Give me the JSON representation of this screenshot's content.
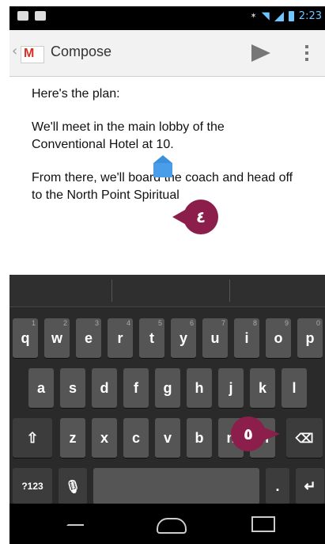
{
  "status_bar": {
    "time": "2:23",
    "icons": [
      "sim-icon",
      "android-icon",
      "vibrate-icon",
      "wifi-icon",
      "signal-icon",
      "battery-icon"
    ]
  },
  "action_bar": {
    "title": "Compose",
    "app_icon": "gmail-icon",
    "actions": [
      "send-icon",
      "overflow-menu-icon"
    ]
  },
  "email_body": {
    "paragraphs": [
      "Here's the plan:",
      "We'll meet in the main lobby of the Conventional Hotel at 10.",
      "From there, we'll board the coach and head off to the North Point Spiritual"
    ]
  },
  "callouts": {
    "cursor_marker": "٤",
    "delete_marker": "٥"
  },
  "keyboard": {
    "row1": [
      "q",
      "w",
      "e",
      "r",
      "t",
      "y",
      "u",
      "i",
      "o",
      "p"
    ],
    "row1_hints": [
      "1",
      "2",
      "3",
      "4",
      "5",
      "6",
      "7",
      "8",
      "9",
      "0"
    ],
    "row2": [
      "a",
      "s",
      "d",
      "f",
      "g",
      "h",
      "j",
      "k",
      "l"
    ],
    "row3": [
      "z",
      "x",
      "c",
      "v",
      "b",
      "n",
      "m"
    ],
    "symbols_label": "?123",
    "period_label": ".",
    "icons": [
      "shift-icon",
      "backspace-icon",
      "mic-icon",
      "enter-icon"
    ]
  },
  "nav_bar": {
    "icons": [
      "back-icon",
      "home-icon",
      "recent-apps-icon"
    ]
  },
  "colors": {
    "callout": "#8b1e4a",
    "cursor_handle": "#4a9de8",
    "accent": "#6ec6ff"
  }
}
